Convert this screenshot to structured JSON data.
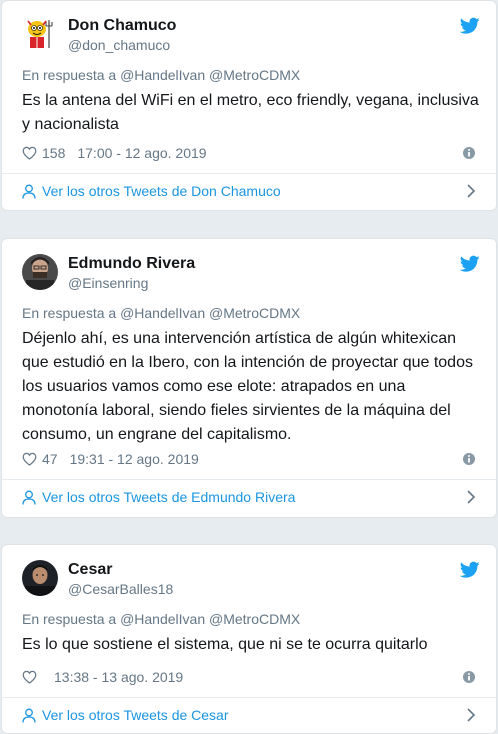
{
  "tweets": [
    {
      "name": "Don Chamuco",
      "handle": "@don_chamuco",
      "reply_prefix": "En respuesta a",
      "reply_to": "@HandelIvan @MetroCDMX",
      "text": "Es la antena del WiFi en el metro, eco friendly, vegana, inclusiva y nacionalista",
      "likes": "158",
      "timestamp": "17:00 - 12 ago. 2019",
      "more_link": "Ver los otros Tweets de Don Chamuco"
    },
    {
      "name": "Edmundo Rivera",
      "handle": "@Einsenring",
      "reply_prefix": "En respuesta a",
      "reply_to": "@HandelIvan @MetroCDMX",
      "text": "Déjenlo ahí, es una intervención artística de algún whitexican que estudió en la Ibero, con la intención de proyectar que todos los usuarios vamos como ese elote: atrapados en una monotonía laboral, siendo fieles sirvientes de la máquina del consumo, un engrane del capitalismo.",
      "likes": "47",
      "timestamp": "19:31 - 12 ago. 2019",
      "more_link": "Ver los otros Tweets de Edmundo Rivera"
    },
    {
      "name": "Cesar",
      "handle": "@CesarBalles18",
      "reply_prefix": "En respuesta a",
      "reply_to": "@HandelIvan @MetroCDMX",
      "text": "Es lo que sostiene el sistema, que ni se te ocurra quitarlo",
      "likes": "",
      "timestamp": "13:38 - 13 ago. 2019",
      "more_link": "Ver los otros Tweets de Cesar"
    }
  ],
  "colors": {
    "twitter_blue": "#1da1f2",
    "link_blue": "#1b95e0",
    "muted": "#657786",
    "background": "#e6ecf0"
  },
  "icons": {
    "brand": "twitter-bird-icon",
    "like": "heart-icon",
    "info": "info-icon",
    "profile": "user-icon",
    "more": "chevron-right-icon"
  }
}
